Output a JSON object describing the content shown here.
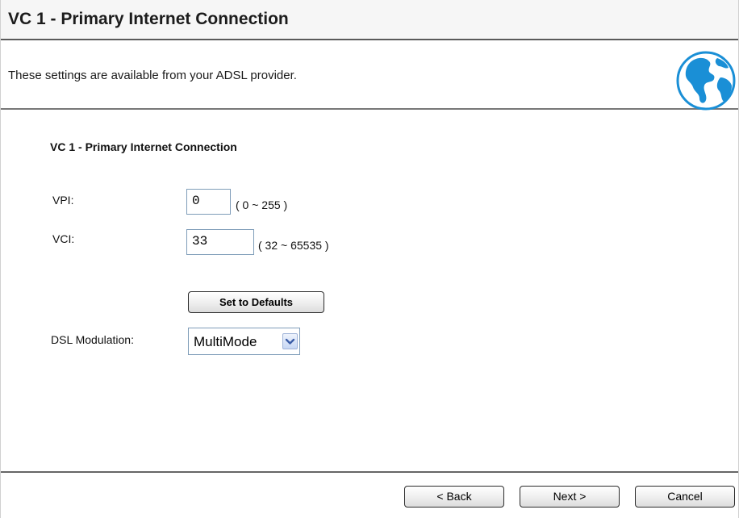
{
  "page": {
    "title": "VC 1 - Primary Internet Connection",
    "description": "These settings are available from your ADSL provider.",
    "section_heading": "VC 1 - Primary Internet Connection"
  },
  "vpi": {
    "label": "VPI:",
    "value": "0",
    "range": "( 0 ~ 255 )"
  },
  "vci": {
    "label": "VCI:",
    "value": "33",
    "range": "( 32 ~ 65535 )"
  },
  "defaults_button": "Set to Defaults",
  "modulation": {
    "label": "DSL Modulation:",
    "selected": "MultiMode"
  },
  "footer": {
    "back_label": "< Back",
    "next_label": "Next >",
    "cancel_label": "Cancel"
  },
  "icons": {
    "globe": "globe-icon",
    "dropdown": "chevron-down-icon"
  },
  "colors": {
    "globe_blue": "#1a8fd6",
    "input_border": "#7f9db9",
    "dropdown_arrow": "#3c5ea8"
  }
}
